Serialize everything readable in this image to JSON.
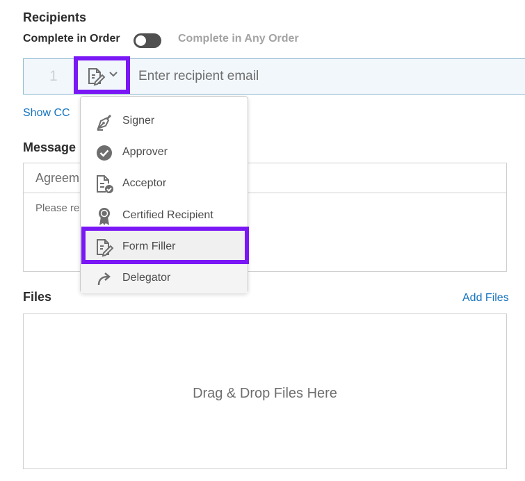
{
  "recipients": {
    "title": "Recipients",
    "complete_in_order_label": "Complete in Order",
    "complete_any_order_label": "Complete in Any Order",
    "toggle_state": "off",
    "row": {
      "number": "1",
      "role_icon": "form-filler-icon",
      "email_placeholder": "Enter recipient email",
      "email_value": ""
    },
    "show_cc_label": "Show CC"
  },
  "role_menu": {
    "items": [
      {
        "label": "Signer",
        "icon": "pen-nib-icon"
      },
      {
        "label": "Approver",
        "icon": "check-circle-icon"
      },
      {
        "label": "Acceptor",
        "icon": "document-check-icon"
      },
      {
        "label": "Certified Recipient",
        "icon": "ribbon-badge-icon"
      },
      {
        "label": "Form Filler",
        "icon": "form-edit-icon",
        "highlighted": true
      },
      {
        "label": "Delegator",
        "icon": "forward-arrow-icon"
      }
    ]
  },
  "message": {
    "title": "Message",
    "subject_value": "Agreem",
    "body_value": "Please re"
  },
  "files": {
    "title": "Files",
    "add_files_label": "Add Files",
    "drop_text": "Drag & Drop Files Here"
  },
  "colors": {
    "highlight": "#7a17f5",
    "link": "#1473bf",
    "recipient_row_bg": "#f2f7fb"
  }
}
